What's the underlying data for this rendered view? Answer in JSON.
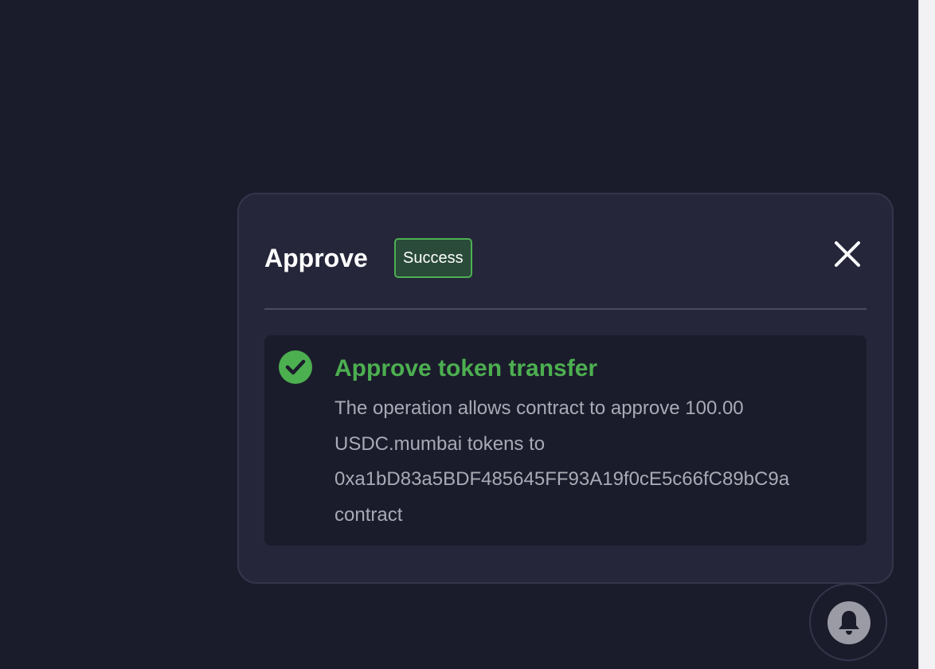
{
  "modal": {
    "title": "Approve",
    "status_badge": "Success",
    "close_icon": "close-icon"
  },
  "operation": {
    "icon": "check-circle-icon",
    "title": "Approve token transfer",
    "description_lines": [
      "The operation allows contract to approve 100.00",
      "USDC.mumbai tokens to",
      "0xa1bD83a5BDF485645FF93A19f0cE5c66fC89bC9a",
      "contract"
    ]
  },
  "notifications": {
    "icon": "bell-icon"
  },
  "colors": {
    "background": "#1b1c2b",
    "modal": "#25263a",
    "success": "#4caf50",
    "text_muted": "#a9aab6"
  }
}
